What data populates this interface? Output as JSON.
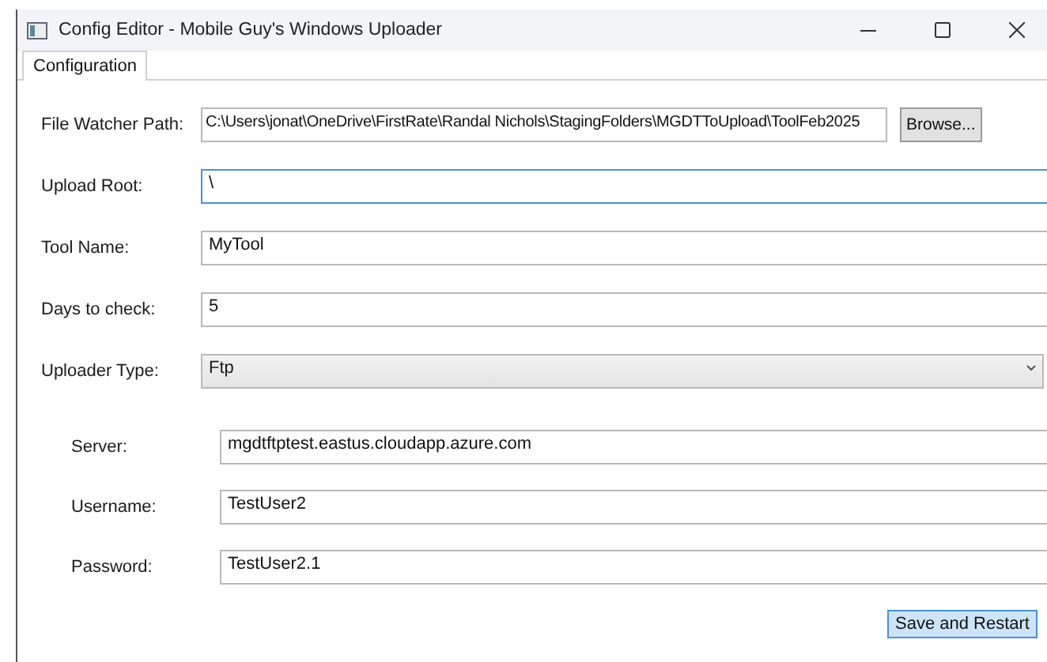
{
  "window": {
    "title": "Config Editor - Mobile Guy's Windows Uploader"
  },
  "tabs": [
    {
      "label": "Configuration",
      "selected": true
    }
  ],
  "fields": [
    {
      "kind": "path",
      "label": "File Watcher Path:",
      "value": "C:\\Users\\jonat\\OneDrive\\FirstRate\\Randal Nichols\\StagingFolders\\MGDTToUpload\\ToolFeb2025",
      "button": "Browse...",
      "focused": false
    },
    {
      "kind": "text",
      "label": "Upload Root:",
      "value": "\\",
      "focused": true
    },
    {
      "kind": "text",
      "label": "Tool Name:",
      "value": "MyTool",
      "focused": false
    },
    {
      "kind": "text",
      "label": "Days to check:",
      "value": "5",
      "focused": false
    },
    {
      "kind": "select",
      "label": "Uploader Type:",
      "value": "Ftp",
      "focused": false
    }
  ],
  "ftp_fields": [
    {
      "label": "Server:",
      "value": "mgdtftptest.eastus.cloudapp.azure.com"
    },
    {
      "label": "Username:",
      "value": "TestUser2"
    },
    {
      "label": "Password:",
      "value": "TestUser2.1"
    }
  ],
  "save_button": "Save and Restart"
}
